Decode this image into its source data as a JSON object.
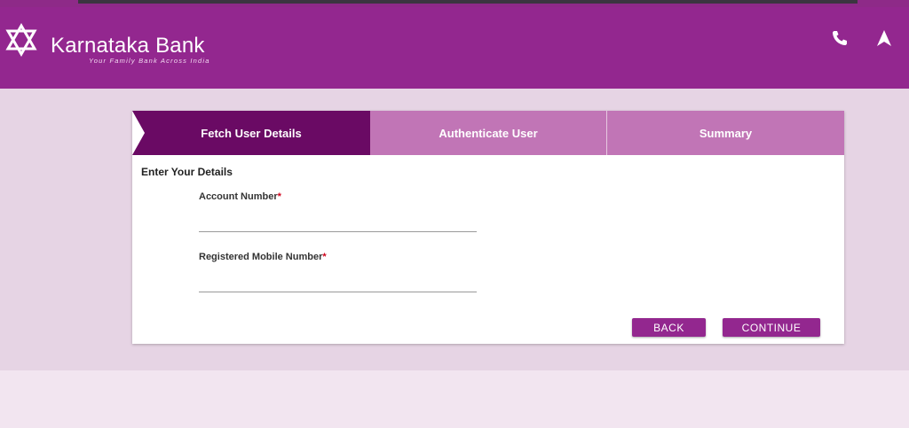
{
  "header": {
    "bank_name": "Karnataka Bank",
    "tagline": "Your Family Bank Across India",
    "icons": [
      "star-of-david-logo-icon",
      "phone-icon",
      "navigation-arrow-icon"
    ],
    "colors": {
      "primary": "#93278f",
      "active_step": "#6a0a64",
      "inactive_step": "#c175b6"
    }
  },
  "steps": [
    {
      "label": "Fetch User Details",
      "active": true
    },
    {
      "label": "Authenticate User",
      "active": false
    },
    {
      "label": "Summary",
      "active": false
    }
  ],
  "form": {
    "section_title": "Enter Your Details",
    "fields": [
      {
        "label": "Account Number",
        "required_mark": "*",
        "value": ""
      },
      {
        "label": "Registered Mobile Number",
        "required_mark": "*",
        "value": ""
      }
    ],
    "back_label": "BACK",
    "continue_label": "CONTINUE"
  }
}
